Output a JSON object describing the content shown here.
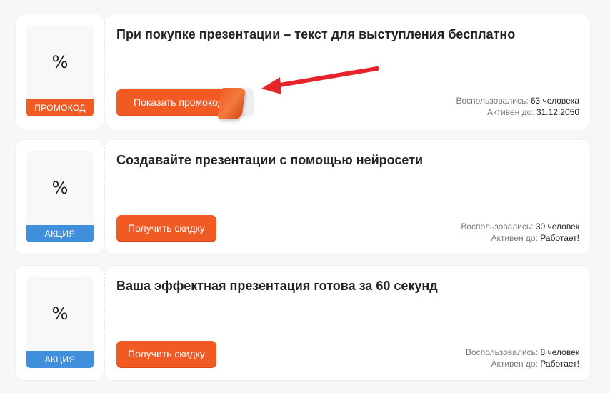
{
  "offers": [
    {
      "type": "promo",
      "icon": "%",
      "tag": "ПРОМОКОД",
      "title": "При покупке презентации – текст для выступления бесплатно",
      "button": "Показать промокод",
      "used_label": "Воспользовались:",
      "used_value": "63 человека",
      "active_label": "Активен до:",
      "active_value": "31.12.2050"
    },
    {
      "type": "action",
      "icon": "%",
      "tag": "АКЦИЯ",
      "title": "Создавайте презентации с помощью нейросети",
      "button": "Получить скидку",
      "used_label": "Воспользовались:",
      "used_value": "30 человек",
      "active_label": "Активен до:",
      "active_value": "Работает!"
    },
    {
      "type": "action",
      "icon": "%",
      "tag": "АКЦИЯ",
      "title": "Ваша эффектная презентация готова за 60 секунд",
      "button": "Получить скидку",
      "used_label": "Воспользовались:",
      "used_value": "8 человек",
      "active_label": "Активен до:",
      "active_value": "Работает!"
    }
  ],
  "colors": {
    "accent": "#f15a23",
    "promo_tag": "#f15a23",
    "action_tag": "#3f8fdc",
    "arrow": "#e6242a"
  }
}
